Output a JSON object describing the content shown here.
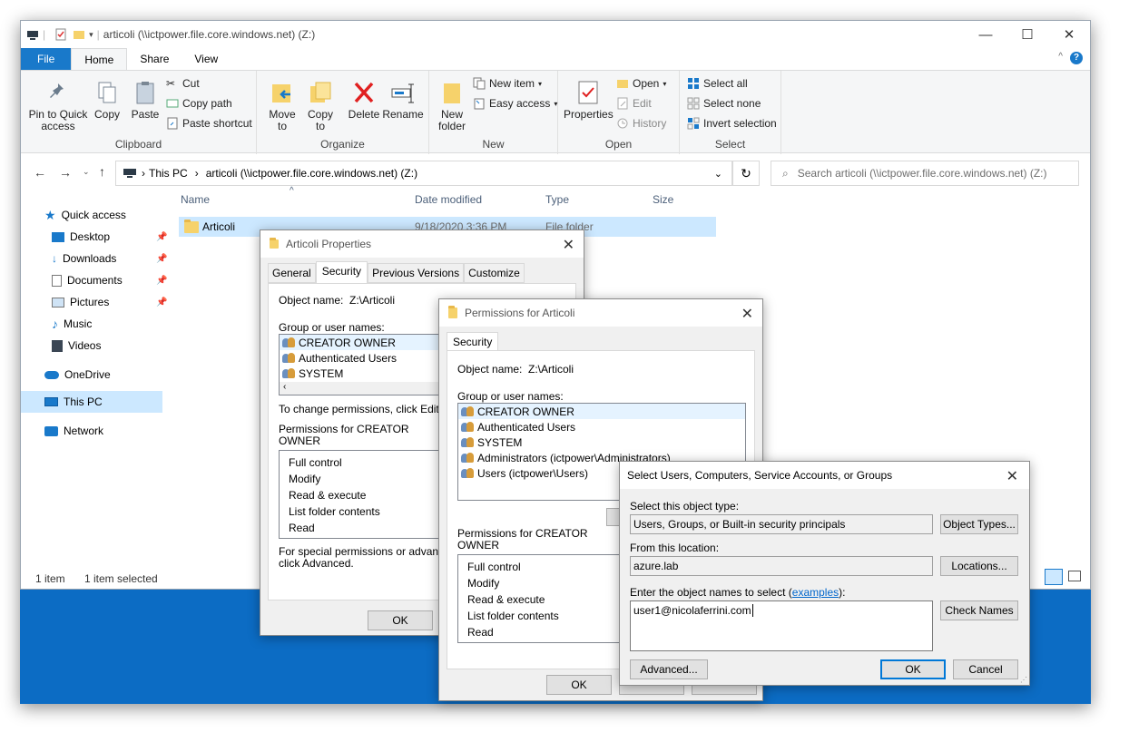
{
  "explorer": {
    "title": "articoli (\\\\ictpower.file.core.windows.net) (Z:)",
    "tabs": [
      "File",
      "Home",
      "Share",
      "View"
    ],
    "ribbon": {
      "clipboard": {
        "pin": "Pin to Quick access",
        "copy": "Copy",
        "paste": "Paste",
        "cut": "Cut",
        "copy_path": "Copy path",
        "paste_shortcut": "Paste shortcut",
        "label": "Clipboard"
      },
      "organize": {
        "move_to": "Move to",
        "copy_to": "Copy to",
        "delete": "Delete",
        "rename": "Rename",
        "label": "Organize"
      },
      "new": {
        "new_folder": "New folder",
        "new_item": "New item",
        "easy_access": "Easy access",
        "label": "New"
      },
      "open": {
        "properties": "Properties",
        "open": "Open",
        "edit": "Edit",
        "history": "History",
        "label": "Open"
      },
      "select": {
        "select_all": "Select all",
        "select_none": "Select none",
        "invert": "Invert selection",
        "label": "Select"
      }
    },
    "address": {
      "this_pc": "This PC",
      "location": "articoli (\\\\ictpower.file.core.windows.net) (Z:)",
      "search_placeholder": "Search articoli (\\\\ictpower.file.core.windows.net) (Z:)"
    },
    "nav": {
      "quick_access": "Quick access",
      "desktop": "Desktop",
      "downloads": "Downloads",
      "documents": "Documents",
      "pictures": "Pictures",
      "music": "Music",
      "videos": "Videos",
      "onedrive": "OneDrive",
      "this_pc": "This PC",
      "network": "Network"
    },
    "columns": {
      "name": "Name",
      "date": "Date modified",
      "type": "Type",
      "size": "Size"
    },
    "file": {
      "name": "Articoli",
      "date": "9/18/2020 3:36 PM",
      "type": "File folder"
    },
    "status": {
      "count": "1 item",
      "selected": "1 item selected"
    }
  },
  "props": {
    "title": "Articoli Properties",
    "tabs": [
      "General",
      "Security",
      "Previous Versions",
      "Customize"
    ],
    "object_label": "Object name:",
    "object_value": "Z:\\Articoli",
    "group_label": "Group or user names:",
    "users": [
      "CREATOR OWNER",
      "Authenticated Users",
      "SYSTEM"
    ],
    "change_text": "To change permissions, click Edit.",
    "perm_label": "Permissions for CREATOR OWNER",
    "perms": [
      "Full control",
      "Modify",
      "Read & execute",
      "List folder contents",
      "Read"
    ],
    "special_text": "For special permissions or advanced s",
    "special_text2": "click Advanced.",
    "ok": "OK"
  },
  "perms_dlg": {
    "title": "Permissions for Articoli",
    "tab": "Security",
    "object_label": "Object name:",
    "object_value": "Z:\\Articoli",
    "group_label": "Group or user names:",
    "users": [
      "CREATOR OWNER",
      "Authenticated Users",
      "SYSTEM",
      "Administrators (ictpower\\Administrators)",
      "Users (ictpower\\Users)"
    ],
    "perm_label": "Permissions for CREATOR OWNER",
    "perms": [
      "Full control",
      "Modify",
      "Read & execute",
      "List folder contents",
      "Read"
    ],
    "ok": "OK"
  },
  "select_dlg": {
    "title": "Select Users, Computers, Service Accounts, or Groups",
    "type_label": "Select this object type:",
    "type_value": "Users, Groups, or Built-in security principals",
    "type_btn": "Object Types...",
    "loc_label": "From this location:",
    "loc_value": "azure.lab",
    "loc_btn": "Locations...",
    "enter_label": "Enter the object names to select (",
    "examples": "examples",
    "enter_label_end": "):",
    "names_value": "user1@nicolaferrini.com",
    "check_btn": "Check Names",
    "advanced_btn": "Advanced...",
    "ok": "OK",
    "cancel": "Cancel"
  },
  "colors": {
    "accent": "#0078d7",
    "file_tab": "#1979ca",
    "desktop": "#0a78d7"
  }
}
